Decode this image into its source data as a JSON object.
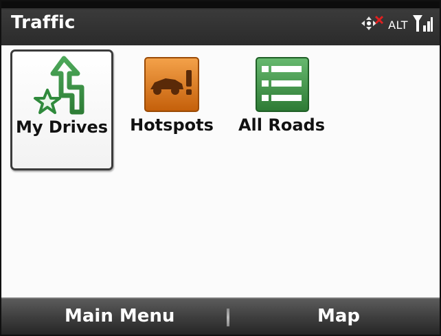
{
  "app": {
    "title": "Traffic"
  },
  "status": {
    "alt_label": "ALT",
    "icons": [
      "navigation-pad-icon",
      "no-connection-x-icon",
      "signal-strength-icon"
    ]
  },
  "tiles": [
    {
      "label": "My Drives",
      "icon": "my-drives-route-star-icon",
      "selected": true
    },
    {
      "label": "Hotspots",
      "icon": "hotspots-car-alert-icon",
      "selected": false
    },
    {
      "label": "All Roads",
      "icon": "all-roads-list-icon",
      "selected": false
    }
  ],
  "softkeys": {
    "left": "Main Menu",
    "right": "Map"
  },
  "colors": {
    "green": "#2f8a3c",
    "orange": "#e07b1a",
    "title_bar": "#2b2b2b",
    "softkey_bar": "#3f3f3f"
  }
}
